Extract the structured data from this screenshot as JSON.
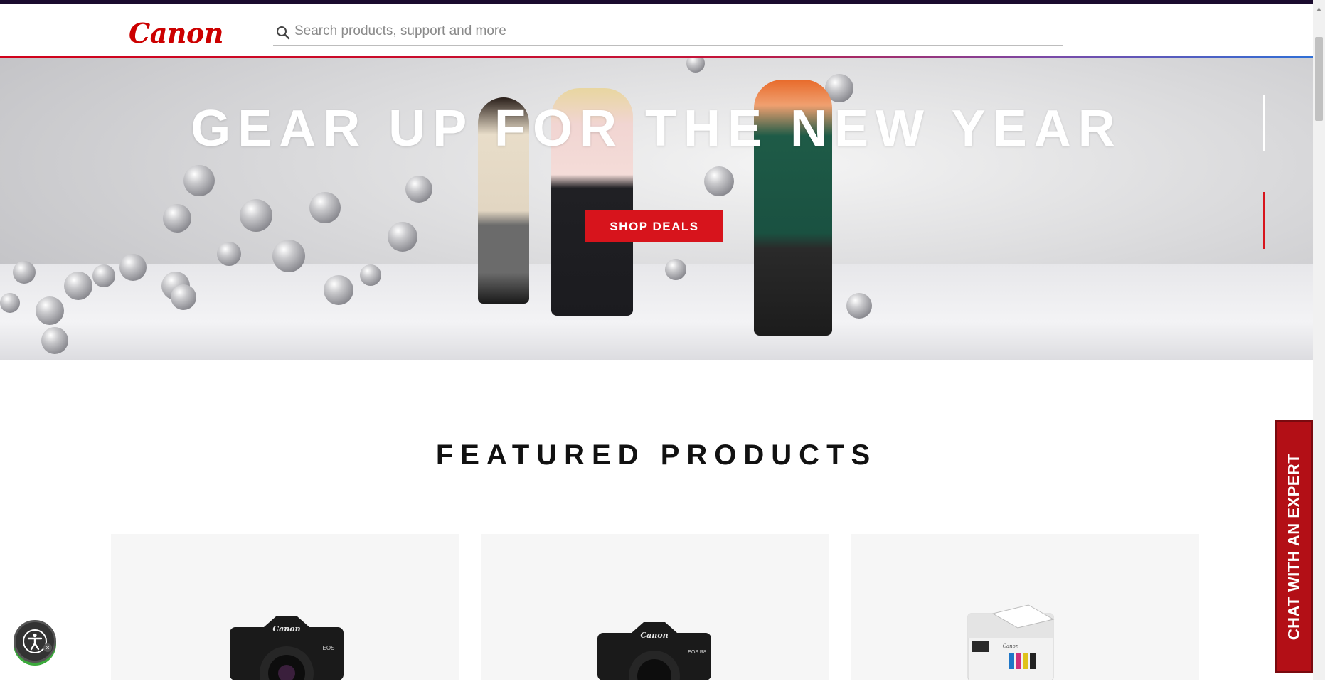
{
  "header": {
    "logo_text": "Canon",
    "search_placeholder": "Search products, support and more"
  },
  "hero": {
    "title": "GEAR UP FOR THE NEW YEAR",
    "cta_label": "SHOP DEALS",
    "slides_total": 2,
    "active_slide": 2
  },
  "featured": {
    "title": "FEATURED PRODUCTS",
    "products": [
      {
        "icon": "mirrorless-camera-icon",
        "brand_mark": "Canon",
        "model_mark": "EOS"
      },
      {
        "icon": "mirrorless-camera-icon",
        "brand_mark": "Canon",
        "model_mark": "EOS R8"
      },
      {
        "icon": "printer-icon",
        "brand_mark": "Canon"
      }
    ]
  },
  "chat": {
    "label": "CHAT WITH AN EXPERT"
  },
  "accessibility": {
    "icon": "accessibility-icon"
  },
  "colors": {
    "brand_red": "#cc0000",
    "cta_red": "#d7141c",
    "chat_red": "#b30f16"
  }
}
